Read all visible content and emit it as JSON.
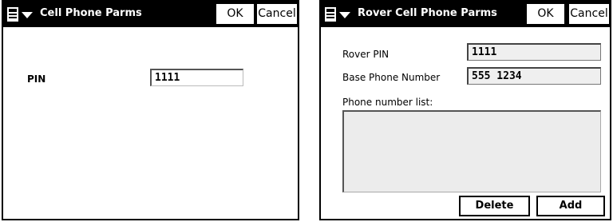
{
  "screen1": {
    "title": "Cell Phone Parms",
    "menu_icon": "menu-dropdown-icon",
    "ok_label": "OK",
    "cancel_label": "Cancel",
    "pin_label": "PIN",
    "pin_value": "1111"
  },
  "screen2": {
    "title": "Rover Cell Phone Parms",
    "menu_icon": "menu-dropdown-icon",
    "ok_label": "OK",
    "cancel_label": "Cancel",
    "rover_pin_label": "Rover PIN",
    "rover_pin_value": "1111",
    "base_phone_label": "Base Phone Number",
    "base_phone_value": "555 1234",
    "phone_list_label": "Phone number list:",
    "phone_list_items": [],
    "delete_label": "Delete",
    "add_label": "Add"
  }
}
